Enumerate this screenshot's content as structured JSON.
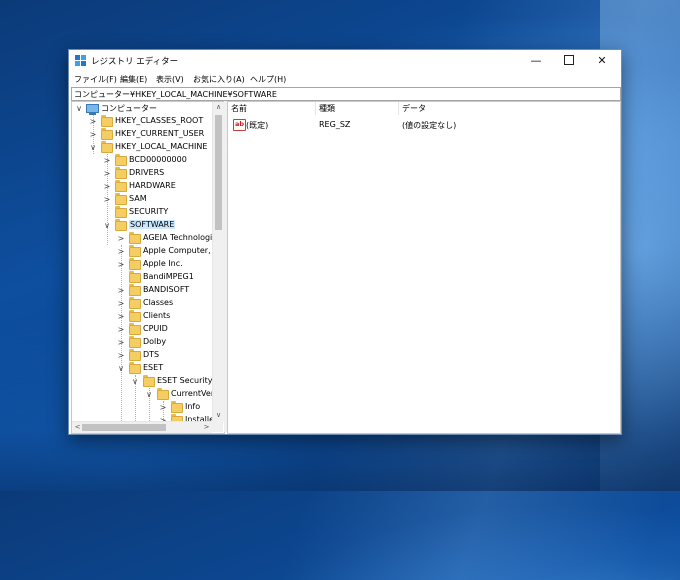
{
  "window": {
    "title": "レジストリ エディター",
    "controls": {
      "minimize": "—",
      "close": "✕"
    }
  },
  "menu": [
    "ファイル(F)",
    "編集(E)",
    "表示(V)",
    "お気に入り(A)",
    "ヘルプ(H)"
  ],
  "address": "コンピューター¥HKEY_LOCAL_MACHINE¥SOFTWARE",
  "tree": [
    {
      "label": "コンピューター",
      "expander": "∨",
      "icon": "computer"
    },
    {
      "label": "HKEY_CLASSES_ROOT",
      "expander": ">"
    },
    {
      "label": "HKEY_CURRENT_USER",
      "expander": ">"
    },
    {
      "label": "HKEY_LOCAL_MACHINE",
      "expander": "∨"
    },
    {
      "label": "BCD00000000",
      "expander": ">"
    },
    {
      "label": "DRIVERS",
      "expander": ">"
    },
    {
      "label": "HARDWARE",
      "expander": ">"
    },
    {
      "label": "SAM",
      "expander": ">"
    },
    {
      "label": "SECURITY",
      "expander": ""
    },
    {
      "label": "SOFTWARE",
      "expander": "∨",
      "selected": true
    },
    {
      "label": "AGEIA Technologi",
      "expander": ">"
    },
    {
      "label": "Apple Computer, I",
      "expander": ">"
    },
    {
      "label": "Apple Inc.",
      "expander": ">"
    },
    {
      "label": "BandiMPEG1",
      "expander": ""
    },
    {
      "label": "BANDISOFT",
      "expander": ">"
    },
    {
      "label": "Classes",
      "expander": ">"
    },
    {
      "label": "Clients",
      "expander": ">"
    },
    {
      "label": "CPUID",
      "expander": ">"
    },
    {
      "label": "Dolby",
      "expander": ">"
    },
    {
      "label": "DTS",
      "expander": ">"
    },
    {
      "label": "ESET",
      "expander": "∨"
    },
    {
      "label": "ESET Security",
      "expander": "∨"
    },
    {
      "label": "CurrentVers",
      "expander": "∨"
    },
    {
      "label": "Info",
      "expander": ">"
    },
    {
      "label": "Installe",
      "expander": ">"
    }
  ],
  "scrollbar": {
    "up": "∧",
    "down": "∨",
    "left": "<",
    "right": ">"
  },
  "columns": {
    "name": "名前",
    "type": "種類",
    "data": "データ"
  },
  "values": [
    {
      "icon_text": "ab",
      "name": "(既定)",
      "type": "REG_SZ",
      "data": "(値の設定なし)"
    }
  ]
}
